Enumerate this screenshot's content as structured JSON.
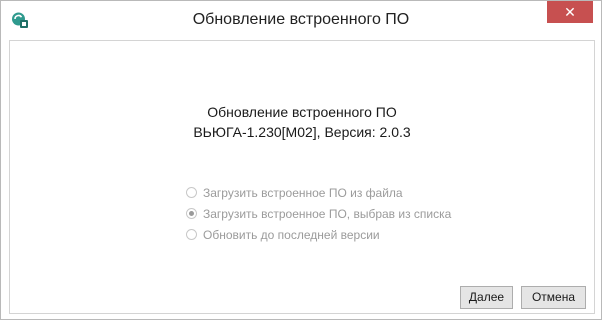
{
  "window": {
    "title": "Обновление встроенного ПО",
    "close_label": "✕",
    "accent": "#c75050"
  },
  "main": {
    "heading_line1": "Обновление встроенного ПО",
    "heading_line2": "ВЬЮГА-1.230[М02], Версия: 2.0.3",
    "options": [
      {
        "label": "Загрузить встроенное ПО из файла",
        "checked": false
      },
      {
        "label": "Загрузить встроенное ПО, выбрав из списка",
        "checked": true
      },
      {
        "label": "Обновить до последней версии",
        "checked": false
      }
    ]
  },
  "buttons": {
    "next": "Далее",
    "cancel": "Отмена"
  },
  "icons": {
    "app": "update-app-icon",
    "close": "close-icon"
  }
}
